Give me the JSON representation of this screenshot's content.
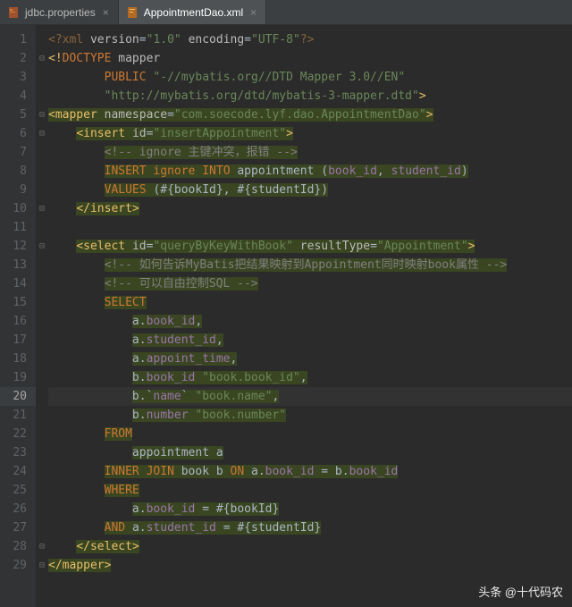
{
  "tabs": [
    {
      "label": "jdbc.properties",
      "active": false
    },
    {
      "label": "AppointmentDao.xml",
      "active": true
    }
  ],
  "watermark": "头条 @十代码农",
  "code": {
    "l1": {
      "open": "<?",
      "name": "xml ",
      "a1": "version",
      "v1": "\"1.0\"",
      "a2": "encoding",
      "v2": "\"UTF-8\"",
      "close": "?>"
    },
    "l2": {
      "open": "<!",
      "kw": "DOCTYPE ",
      "name": "mapper"
    },
    "l3": {
      "kw": "PUBLIC ",
      "v": "\"-//mybatis.org//DTD Mapper 3.0//EN\""
    },
    "l4": {
      "v": "\"http://mybatis.org/dtd/mybatis-3-mapper.dtd\"",
      "close": ">"
    },
    "l5": {
      "open": "<",
      "name": "mapper ",
      "a1": "namespace",
      "v1": "\"com.soecode.lyf.dao.AppointmentDao\"",
      "close": ">"
    },
    "l6": {
      "open": "<",
      "name": "insert ",
      "a1": "id",
      "v1": "\"insertAppointment\"",
      "close": ">"
    },
    "l7": {
      "c": "<!-- ignore 主键冲突，报错 -->"
    },
    "l8": {
      "k1": "INSERT ",
      "k2": "ignore ",
      "k3": "INTO ",
      "t1": "appointment ",
      "p": "(",
      "c1": "book_id",
      "comma": ", ",
      "c2": "student_id",
      "p2": ")"
    },
    "l9": {
      "k1": "VALUES ",
      "t": "(#{bookId}, #{studentId})"
    },
    "l10": {
      "open": "</",
      "name": "insert",
      "close": ">"
    },
    "l12": {
      "open": "<",
      "name": "select ",
      "a1": "id",
      "v1": "\"queryByKeyWithBook\"",
      "a2": "resultType",
      "v2": "\"Appointment\"",
      "close": ">"
    },
    "l13": {
      "c": "<!-- 如何告诉MyBatis把结果映射到Appointment同时映射book属性 -->"
    },
    "l14": {
      "c": "<!-- 可以自由控制SQL -->"
    },
    "l15": {
      "k": "SELECT"
    },
    "l16": {
      "t": "a.",
      "c": "book_id",
      "comma": ","
    },
    "l17": {
      "t": "a.",
      "c": "student_id",
      "comma": ","
    },
    "l18": {
      "t": "a.",
      "c": "appoint_time",
      "comma": ","
    },
    "l19": {
      "t": "b.",
      "c": "book_id ",
      "s": "\"book.book_id\"",
      "comma": ","
    },
    "l20": {
      "t": "b.",
      "bt": "`",
      "c": "name",
      "bt2": "` ",
      "s": "\"book.name\"",
      "comma": ","
    },
    "l21": {
      "t": "b.",
      "c": "number ",
      "s": "\"book.number\""
    },
    "l22": {
      "k": "FROM"
    },
    "l23": {
      "t": "appointment a"
    },
    "l24": {
      "k1": "INNER JOIN ",
      "t1": "book b ",
      "k2": "ON ",
      "t2": "a.",
      "c1": "book_id ",
      "eq": "= b.",
      "c2": "book_id"
    },
    "l25": {
      "k": "WHERE"
    },
    "l26": {
      "t": "a.",
      "c": "book_id ",
      "rest": "= #{bookId}"
    },
    "l27": {
      "k": "AND ",
      "t": "a.",
      "c": "student_id ",
      "rest": "= #{studentId}"
    },
    "l28": {
      "open": "</",
      "name": "select",
      "close": ">"
    },
    "l29": {
      "open": "</",
      "name": "mapper",
      "close": ">"
    }
  },
  "active_line": 20,
  "line_count": 29
}
